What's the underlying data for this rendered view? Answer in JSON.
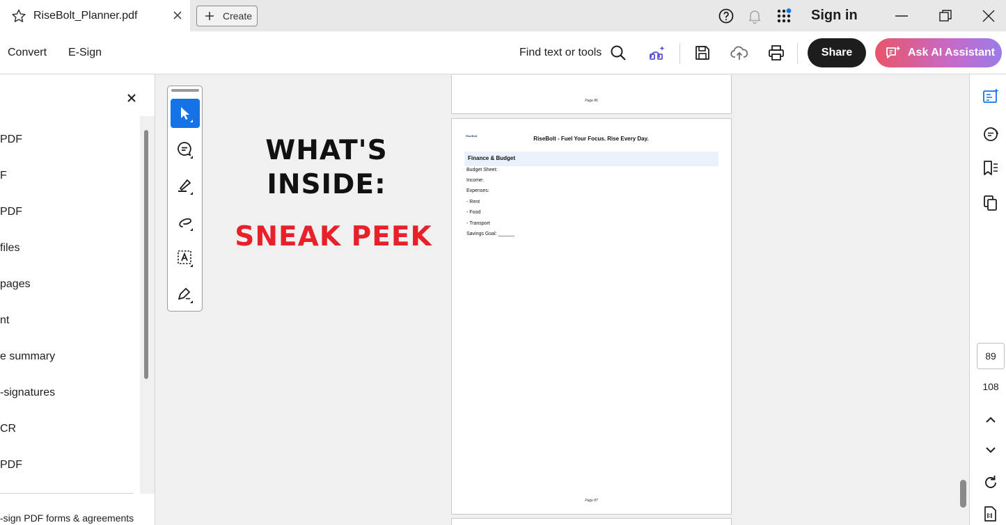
{
  "tab": {
    "title": "RiseBolt_Planner.pdf"
  },
  "create_button": {
    "label": "Create"
  },
  "header": {
    "sign_in": "Sign in"
  },
  "toolbar": {
    "menu": [
      "Convert",
      "E-Sign"
    ],
    "find_label": "Find text or tools",
    "share_label": "Share",
    "ai_label": "Ask AI Assistant"
  },
  "left_panel": {
    "items": [
      "PDF",
      "F",
      "PDF",
      "files",
      "pages",
      "nt",
      "e summary",
      "-signatures",
      "CR",
      "PDF"
    ],
    "footer": "-sign PDF forms & agreements"
  },
  "promo": {
    "line1": "WHAT'S",
    "line2": "INSIDE:",
    "line3": "SNEAK PEEK"
  },
  "prev_page": {
    "page_label": "Page 86"
  },
  "main_page": {
    "logo_text": "RiseBolt",
    "header": "RiseBolt - Fuel Your Focus. Rise Every Day.",
    "section_title": "Finance & Budget",
    "lines": [
      "Budget Sheet:",
      "Income:",
      "Expenses:",
      "- Rent",
      "- Food",
      "- Transport",
      "Savings Goal: ______"
    ],
    "page_label": "Page 87"
  },
  "page_nav": {
    "current": "89",
    "total": "108"
  },
  "colors": {
    "accent": "#1473e6",
    "promo_red": "#e8202a",
    "share_bg": "#1d1d1d"
  }
}
